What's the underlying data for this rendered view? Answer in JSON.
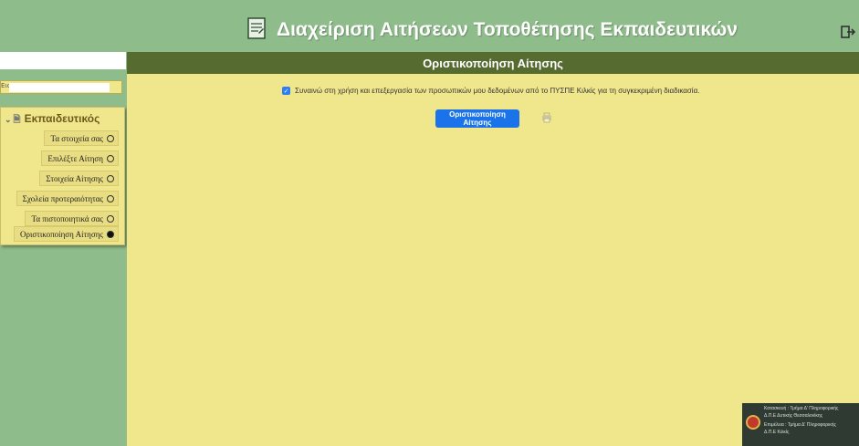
{
  "header": {
    "title": "Διαχείριση Αιτήσεων Τοποθέτησης Εκπαιδευτικών",
    "icon": "document-icon",
    "logout_icon": "logout-icon"
  },
  "sidebar": {
    "search": {
      "placeholder": "",
      "value": ""
    },
    "small_input": {
      "placeholder": "Εισ..."
    },
    "tree": {
      "root_label": "Εκπαιδευτικός",
      "items": [
        {
          "label": "Τα στοιχεία σας",
          "active": false
        },
        {
          "label": "Επιλέξτε Αίτηση",
          "active": false
        },
        {
          "label": "Στοιχεία Αίτησης",
          "active": false
        },
        {
          "label": "Σχολεία προτεραιότητας",
          "active": false
        },
        {
          "label": "Τα πιστοποιητικά σας",
          "active": false
        },
        {
          "label": "Οριστικοποίηση Αίτησης",
          "active": true
        }
      ]
    }
  },
  "main": {
    "title": "Οριστικοποίηση Αίτησης",
    "consent_text": "Συναινώ στη χρήση και επεξεργασία των προσωπικών μου δεδομένων από το ΠΥΣΠΕ Κιλκίς για τη συγκεκριμένη διαδικασία.",
    "consent_checked": true,
    "finalize_button": "Οριστικοποίηση Αίτησης",
    "print_icon": "printer-icon"
  },
  "credits": {
    "line1": "Κατασκευή : Τμήμα Δ' Πληροφορικής",
    "line2": "Δ.Π.Ε Δυτικής Θεσσαλονίκης",
    "line3": "Επιμέλεια : Τμήμα Δ' Πληροφορικής",
    "line4": "Δ.Π.Ε Κιλκίς"
  },
  "colors": {
    "sidebar_bg": "#8fbc8b",
    "main_bg": "#f0e68c",
    "main_header_bg": "#556b2f",
    "button_bg": "#1a73e8"
  }
}
